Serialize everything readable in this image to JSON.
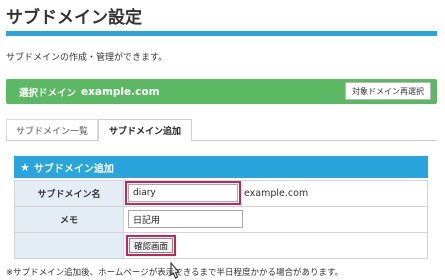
{
  "page": {
    "title": "サブドメイン設定",
    "description": "サブドメインの作成・管理ができます。"
  },
  "domain_bar": {
    "label": "選択ドメイン",
    "value": "example.com",
    "reselect_button": "対象ドメイン再選択"
  },
  "tabs": [
    {
      "label": "サブドメイン一覧",
      "active": false
    },
    {
      "label": "サブドメイン追加",
      "active": true
    }
  ],
  "section": {
    "icon": "star-icon",
    "title": "サブドメイン追加"
  },
  "form": {
    "subdomain_label": "サブドメイン名",
    "subdomain_value": "diary",
    "domain_suffix": "example.com",
    "memo_label": "メモ",
    "memo_value": "日記用",
    "confirm_button": "確認画面"
  },
  "footer_note": "※サブドメイン追加後、ホームページが表示できるまで半日程度かかる場合があります。",
  "colors": {
    "accent_blue": "#2aa5dc",
    "domain_green": "#5cb963",
    "highlight_red": "#cc2255",
    "label_cell_bg": "#e4edf6"
  }
}
